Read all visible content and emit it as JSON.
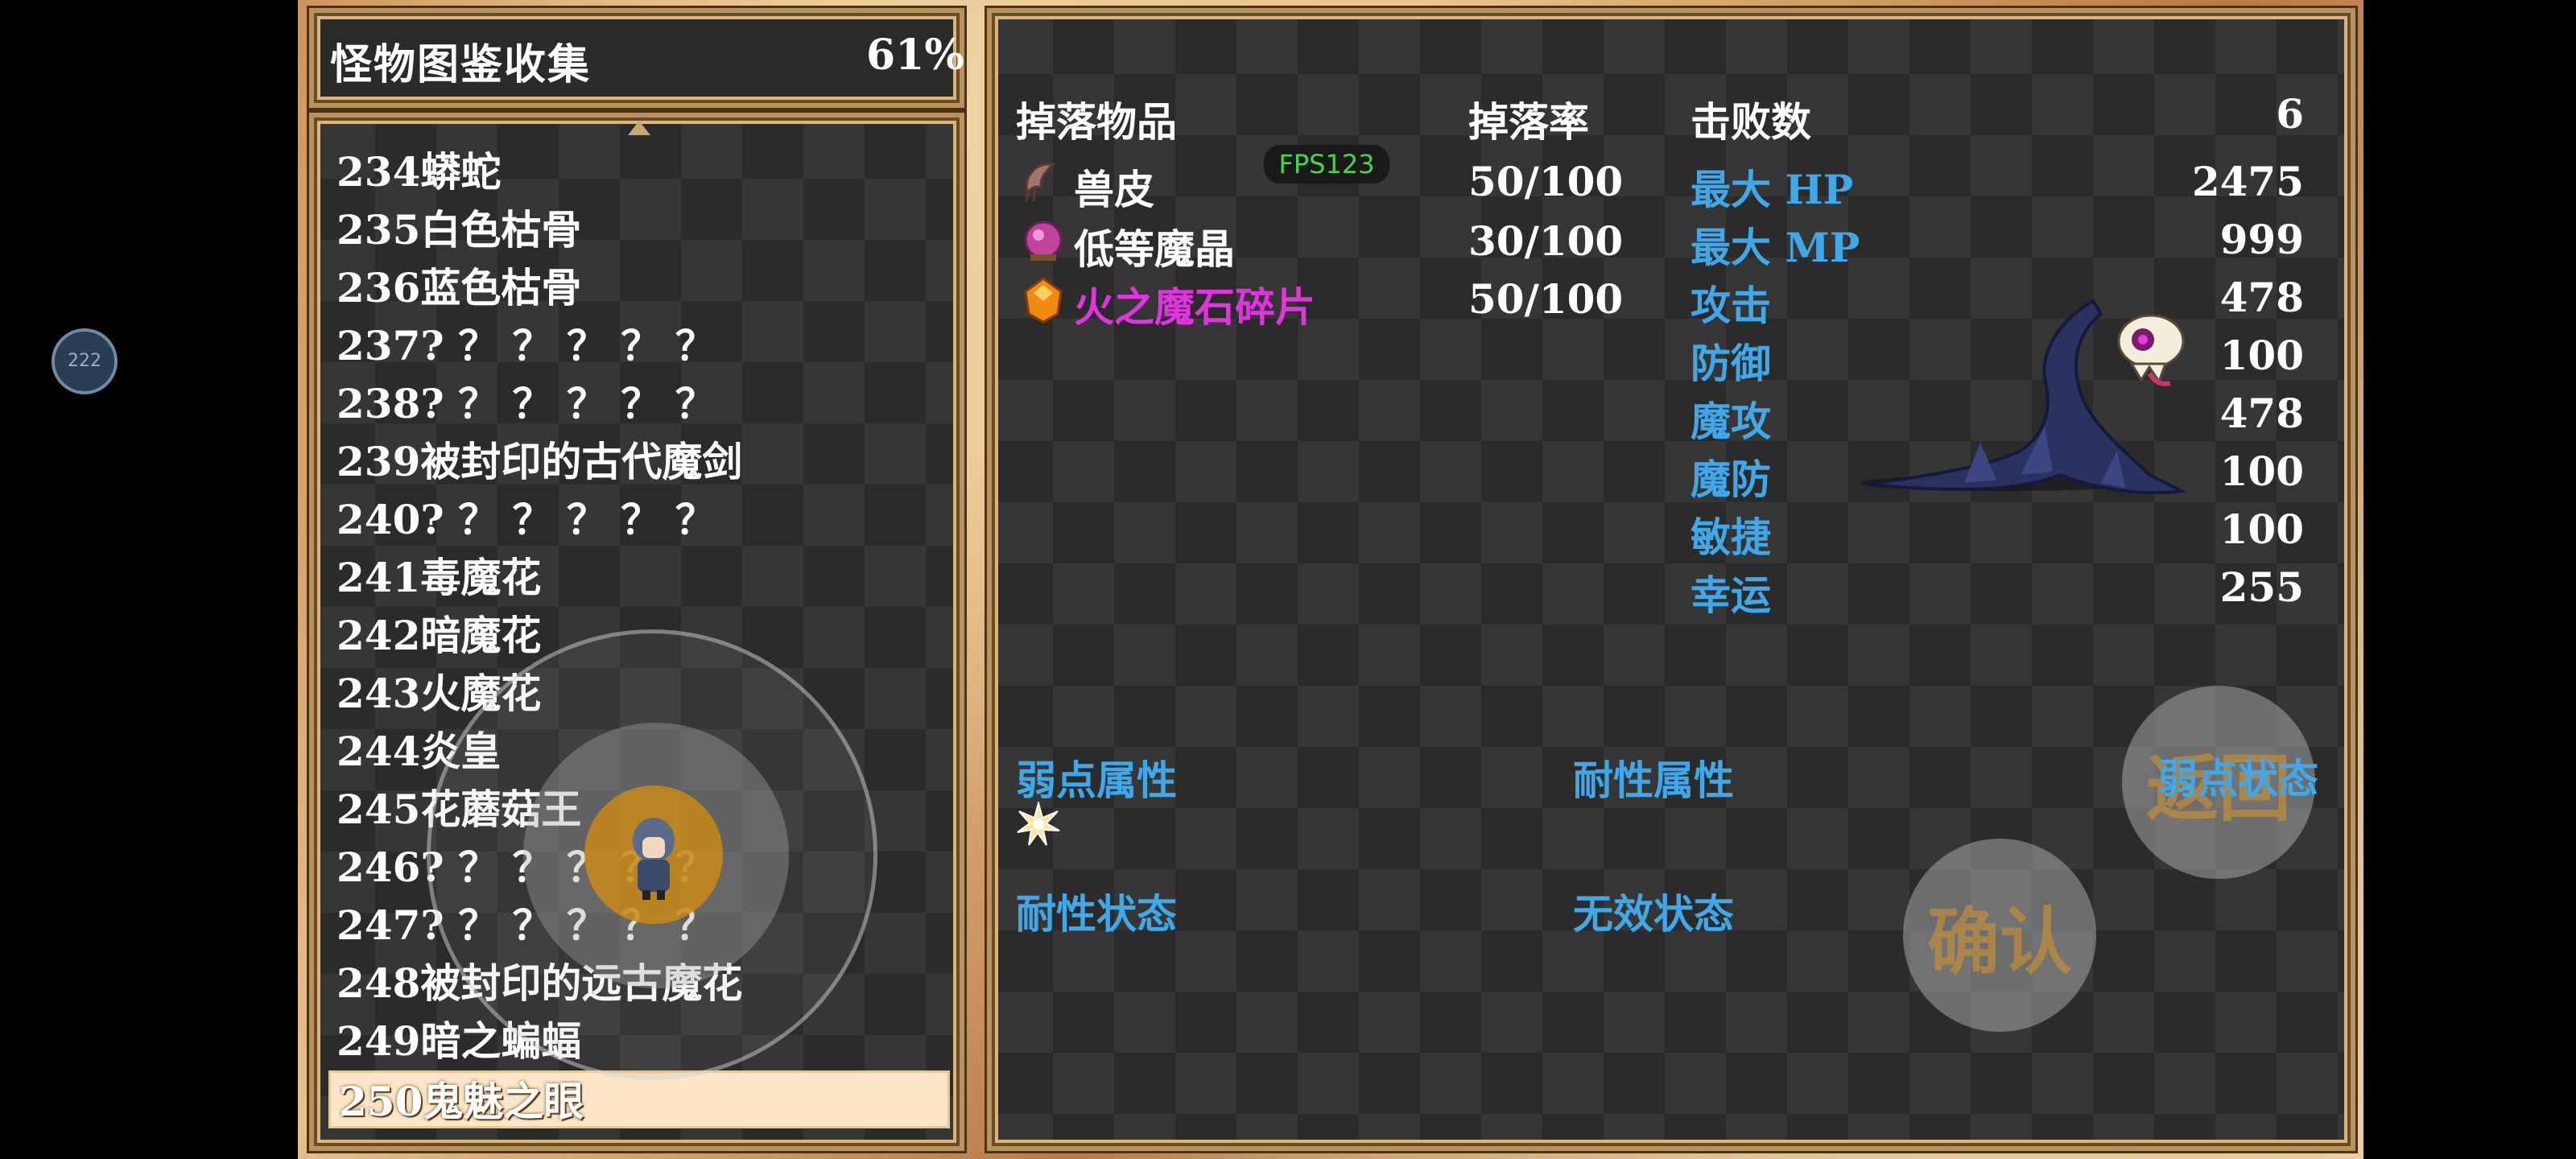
{
  "header": {
    "title": "怪物图鉴收集",
    "percent": "61%"
  },
  "list": {
    "items": [
      "234蟒蛇",
      "235白色枯骨",
      "236蓝色枯骨",
      "237? ？ ？ ？ ？ ？",
      "238? ？ ？ ？ ？ ？",
      "239被封印的古代魔剑",
      "240? ？ ？ ？ ？ ？",
      "241毒魔花",
      "242暗魔花",
      "243火魔花",
      "244炎皇",
      "245花蘑菇王",
      "246? ？ ？ ？ ？ ？",
      "247? ？ ？ ？ ？ ？",
      "248被封印的远古魔花",
      "249暗之蝙蝠",
      "250鬼魅之眼"
    ],
    "selected_index": 16
  },
  "drops": {
    "header_item": "掉落物品",
    "header_rate": "掉落率",
    "items": [
      {
        "name": "兽皮",
        "rate": "50/100",
        "icon": "fur-icon"
      },
      {
        "name": "低等魔晶",
        "rate": "30/100",
        "icon": "crystal-icon"
      },
      {
        "name": "火之魔石碎片",
        "rate": "50/100",
        "icon": "fire-stone-icon"
      }
    ]
  },
  "stats": {
    "defeat_label": "击败数",
    "defeat_value": "6",
    "hp_label": "最大 HP",
    "hp_value": "2475",
    "mp_label": "最大 MP",
    "mp_value": "999",
    "atk_label": "攻击",
    "atk_value": "478",
    "def_label": "防御",
    "def_value": "100",
    "matk_label": "魔攻",
    "matk_value": "478",
    "mdef_label": "魔防",
    "mdef_value": "100",
    "agi_label": "敏捷",
    "agi_value": "100",
    "luck_label": "幸运",
    "luck_value": "255"
  },
  "attributes": {
    "weak_attr": "弱点属性",
    "resist_attr": "耐性属性",
    "weak_state": "弱点状态",
    "resist_state": "耐性状态",
    "immune_state": "无效状态"
  },
  "overlay": {
    "fps": "FPS123",
    "back_button": "返回",
    "confirm_button": "确认",
    "floating_badge": "222"
  },
  "colors": {
    "label_blue": "#40a8e8",
    "rare_item": "#e233e0",
    "fps_green": "#4cd34c"
  }
}
